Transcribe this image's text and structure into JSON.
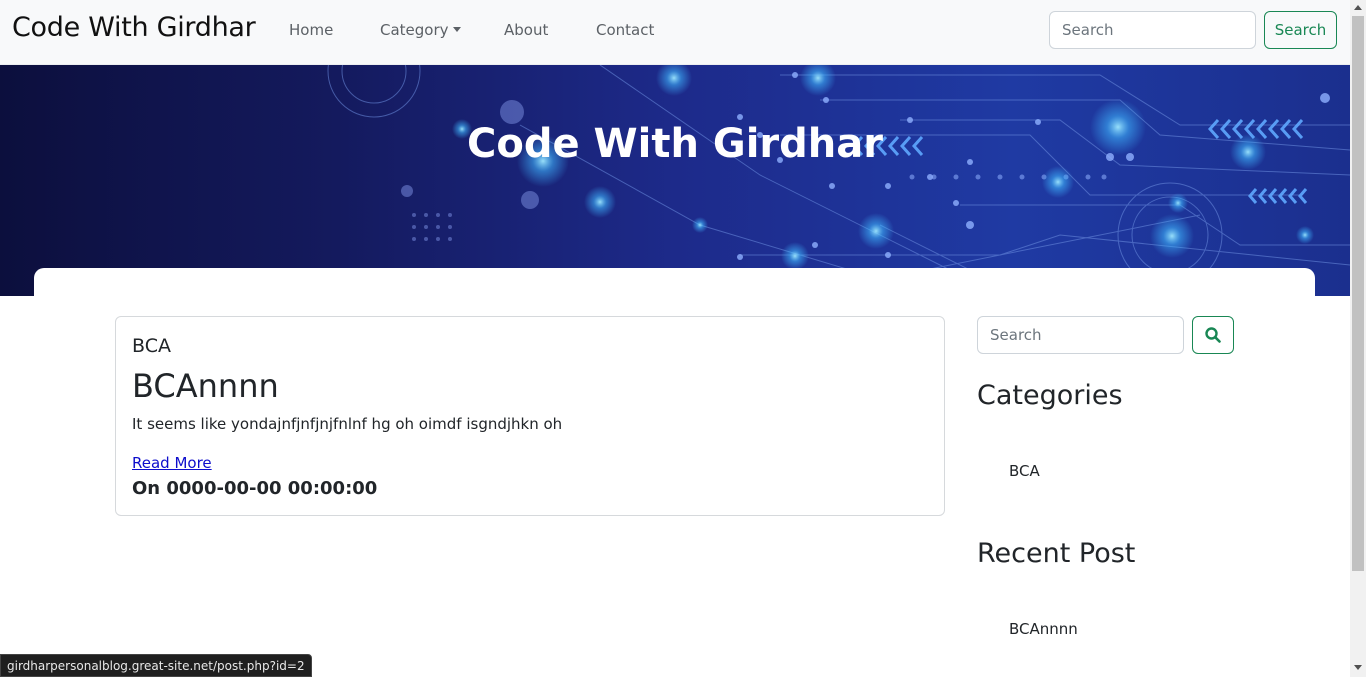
{
  "navbar": {
    "brand": "Code With Girdhar",
    "links": [
      "Home",
      "Category",
      "About",
      "Contact"
    ],
    "search_placeholder": "Search",
    "search_button": "Search"
  },
  "hero": {
    "title": "Code With Girdhar"
  },
  "post": {
    "category": "BCA",
    "title": "BCAnnnn",
    "excerpt": "It seems like yondajnfjnfjnjfnlnf hg oh oimdf isgndjhkn oh",
    "read_more": "Read More",
    "date": "On 0000-00-00 00:00:00"
  },
  "sidebar": {
    "search_placeholder": "Search",
    "categories_heading": "Categories",
    "categories": [
      "BCA"
    ],
    "recent_heading": "Recent Post",
    "recent": [
      "BCAnnnn"
    ]
  },
  "status_url": "girdharpersonalblog.great-site.net/post.php?id=2",
  "colors": {
    "accent": "#198754",
    "link": "#0d0dcc",
    "hero": "#1d2a8a"
  },
  "icons": {
    "sidebar_search": "search-icon",
    "category_dropdown": "chevron-down-icon"
  }
}
